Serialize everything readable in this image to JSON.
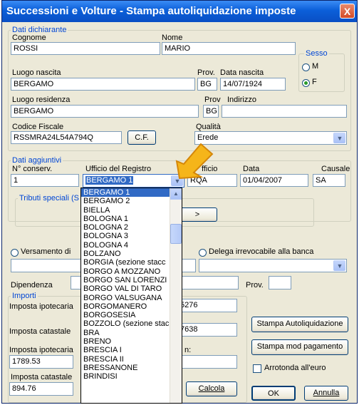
{
  "window": {
    "title": "Successioni e Volture - Stampa autoliquidazione imposte",
    "close_label": "X"
  },
  "dichiarante": {
    "group_label": "Dati dichiarante",
    "cognome_label": "Cognome",
    "cognome_value": "ROSSI",
    "nome_label": "Nome",
    "nome_value": "MARIO",
    "sesso_label": "Sesso",
    "sesso_m": "M",
    "sesso_f": "F",
    "sesso_selected": "F",
    "luogo_nascita_label": "Luogo nascita",
    "luogo_nascita_value": "BERGAMO",
    "prov_nascita_label": "Prov.",
    "prov_nascita_value": "BG",
    "data_nascita_label": "Data nascita",
    "data_nascita_value": "14/07/1924",
    "luogo_residenza_label": "Luogo residenza",
    "luogo_residenza_value": "BERGAMO",
    "prov_res_label": "Prov",
    "prov_res_value": "BG",
    "indirizzo_label": "Indirizzo",
    "indirizzo_value": "",
    "codice_fiscale_label": "Codice Fiscale",
    "codice_fiscale_value": "RSSMRA24L54A794Q",
    "cf_button": "C.F.",
    "qualita_label": "Qualità",
    "qualita_value": "Erede"
  },
  "aggiuntivi": {
    "group_label": "Dati aggiuntivi",
    "n_conserv_label": "N° conserv.",
    "n_conserv_value": "1",
    "ufficio_registro_label": "Ufficio del Registro",
    "ufficio_registro_value": "BERGAMO 1",
    "ufficio_label": "fficio",
    "ufficio_value": "RQA",
    "data_label": "Data",
    "data_value": "01/04/2007",
    "causale_label": "Causale",
    "causale_value": "SA",
    "tributi_label": "Tributi speciali (S",
    "tributi_button": ">"
  },
  "dropdown_options": [
    "BERGAMO 1",
    "BERGAMO 2",
    "BIELLA",
    "BOLOGNA 1",
    "BOLOGNA 2",
    "BOLOGNA 3",
    "BOLOGNA 4",
    "BOLZANO",
    "BORGIA (sezione stacc",
    "BORGO A MOZZANO",
    "BORGO SAN LORENZI",
    "BORGO VAL DI TARO",
    "BORGO VALSUGANA",
    "BORGOMANERO",
    "BORGOSESIA",
    "BOZZOLO (sezione stac",
    "BRA",
    "BRENO",
    "BRESCIA I",
    "BRESCIA II",
    "BRESSANONE",
    "BRINDISI"
  ],
  "versamento": {
    "versamento_label": "Versamento di",
    "delega_label": "Delega irrevocabile alla banca",
    "dipendenza_label": "Dipendenza",
    "prov_label": "Prov."
  },
  "importi": {
    "group_label": "Importi",
    "imp_ipotecaria_label": "Imposta ipotecaria",
    "imp_ipotecaria_value": "5276",
    "imp_catastale_label": "Imposta catastale",
    "imp_catastale_value": "7638",
    "imp_ipotecaria2_label": "Imposta ipotecaria",
    "imp_ipotecaria2_value": "1789.53",
    "extra_label": "n:",
    "imp_catastale2_label": "Imposta catastale",
    "imp_catastale2_value": "894.76",
    "calcola_button": "Calcola"
  },
  "buttons": {
    "stampa_autoliq": "Stampa Autoliquidazione",
    "stampa_mod": "Stampa mod pagamento",
    "arrotonda": "Arrotonda all'euro",
    "ok": "OK",
    "annulla": "Annulla"
  }
}
